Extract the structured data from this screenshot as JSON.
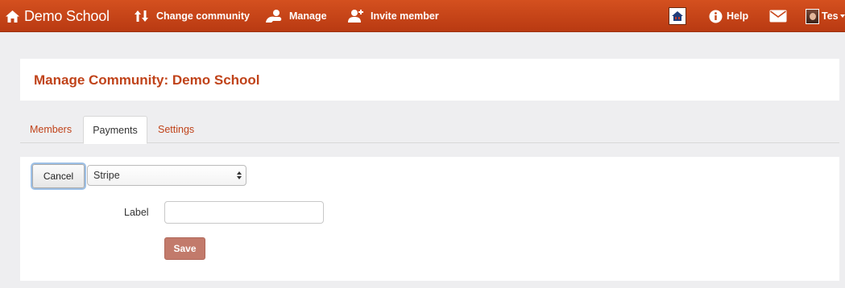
{
  "navbar": {
    "brand_label": "Demo School",
    "change_community_label": "Change community",
    "manage_label": "Manage",
    "invite_member_label": "Invite member",
    "help_label": "Help",
    "user_label": "Tes",
    "colors": {
      "background": "#c8461a",
      "text": "#ffffff"
    }
  },
  "page": {
    "title": "Manage Community: Demo School",
    "accent_color": "#c0431a"
  },
  "tabs": [
    {
      "label": "Members",
      "active": false
    },
    {
      "label": "Payments",
      "active": true
    },
    {
      "label": "Settings",
      "active": false
    }
  ],
  "form": {
    "cancel_label": "Cancel",
    "gateway_select": {
      "selected": "Stripe"
    },
    "label_field": {
      "label": "Label",
      "value": "",
      "placeholder": ""
    },
    "save_label": "Save"
  },
  "icons": [
    "home-icon",
    "change-arrows-icon",
    "manage-user-icon",
    "invite-member-icon",
    "community-home-icon",
    "info-icon",
    "mail-icon",
    "avatar",
    "caret-down-icon"
  ]
}
